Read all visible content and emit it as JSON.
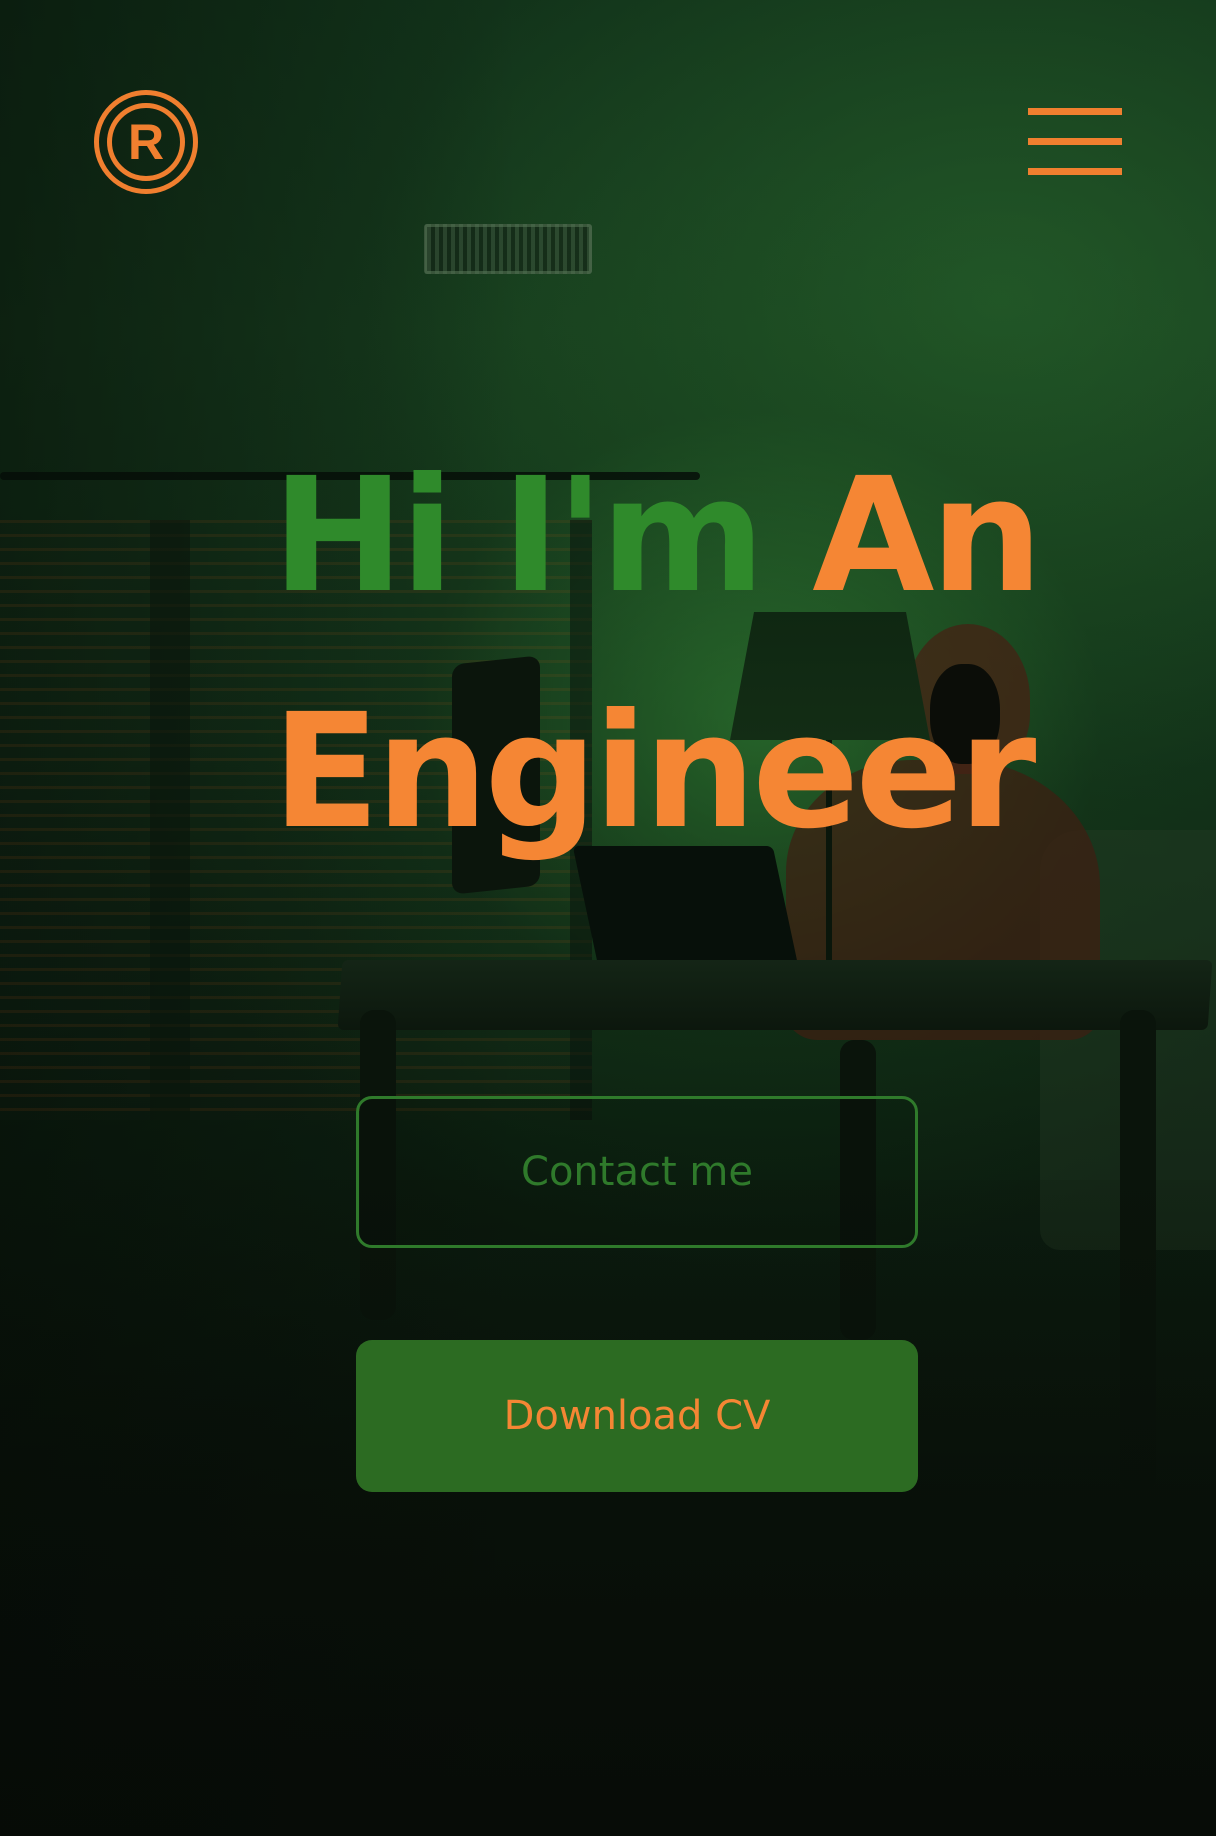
{
  "header": {
    "logo_letter": "R",
    "logo_icon": "registered-trademark-icon",
    "menu_icon": "hamburger-menu-icon"
  },
  "hero": {
    "title_part_green": "Hi I'm",
    "title_part_orange_1": "An",
    "title_part_orange_2": "Engineer"
  },
  "actions": {
    "contact_label": "Contact me",
    "download_label": "Download CV"
  },
  "colors": {
    "accent_orange": "#f58634",
    "accent_green": "#2f8a2b",
    "button_green": "#2c6b22"
  }
}
